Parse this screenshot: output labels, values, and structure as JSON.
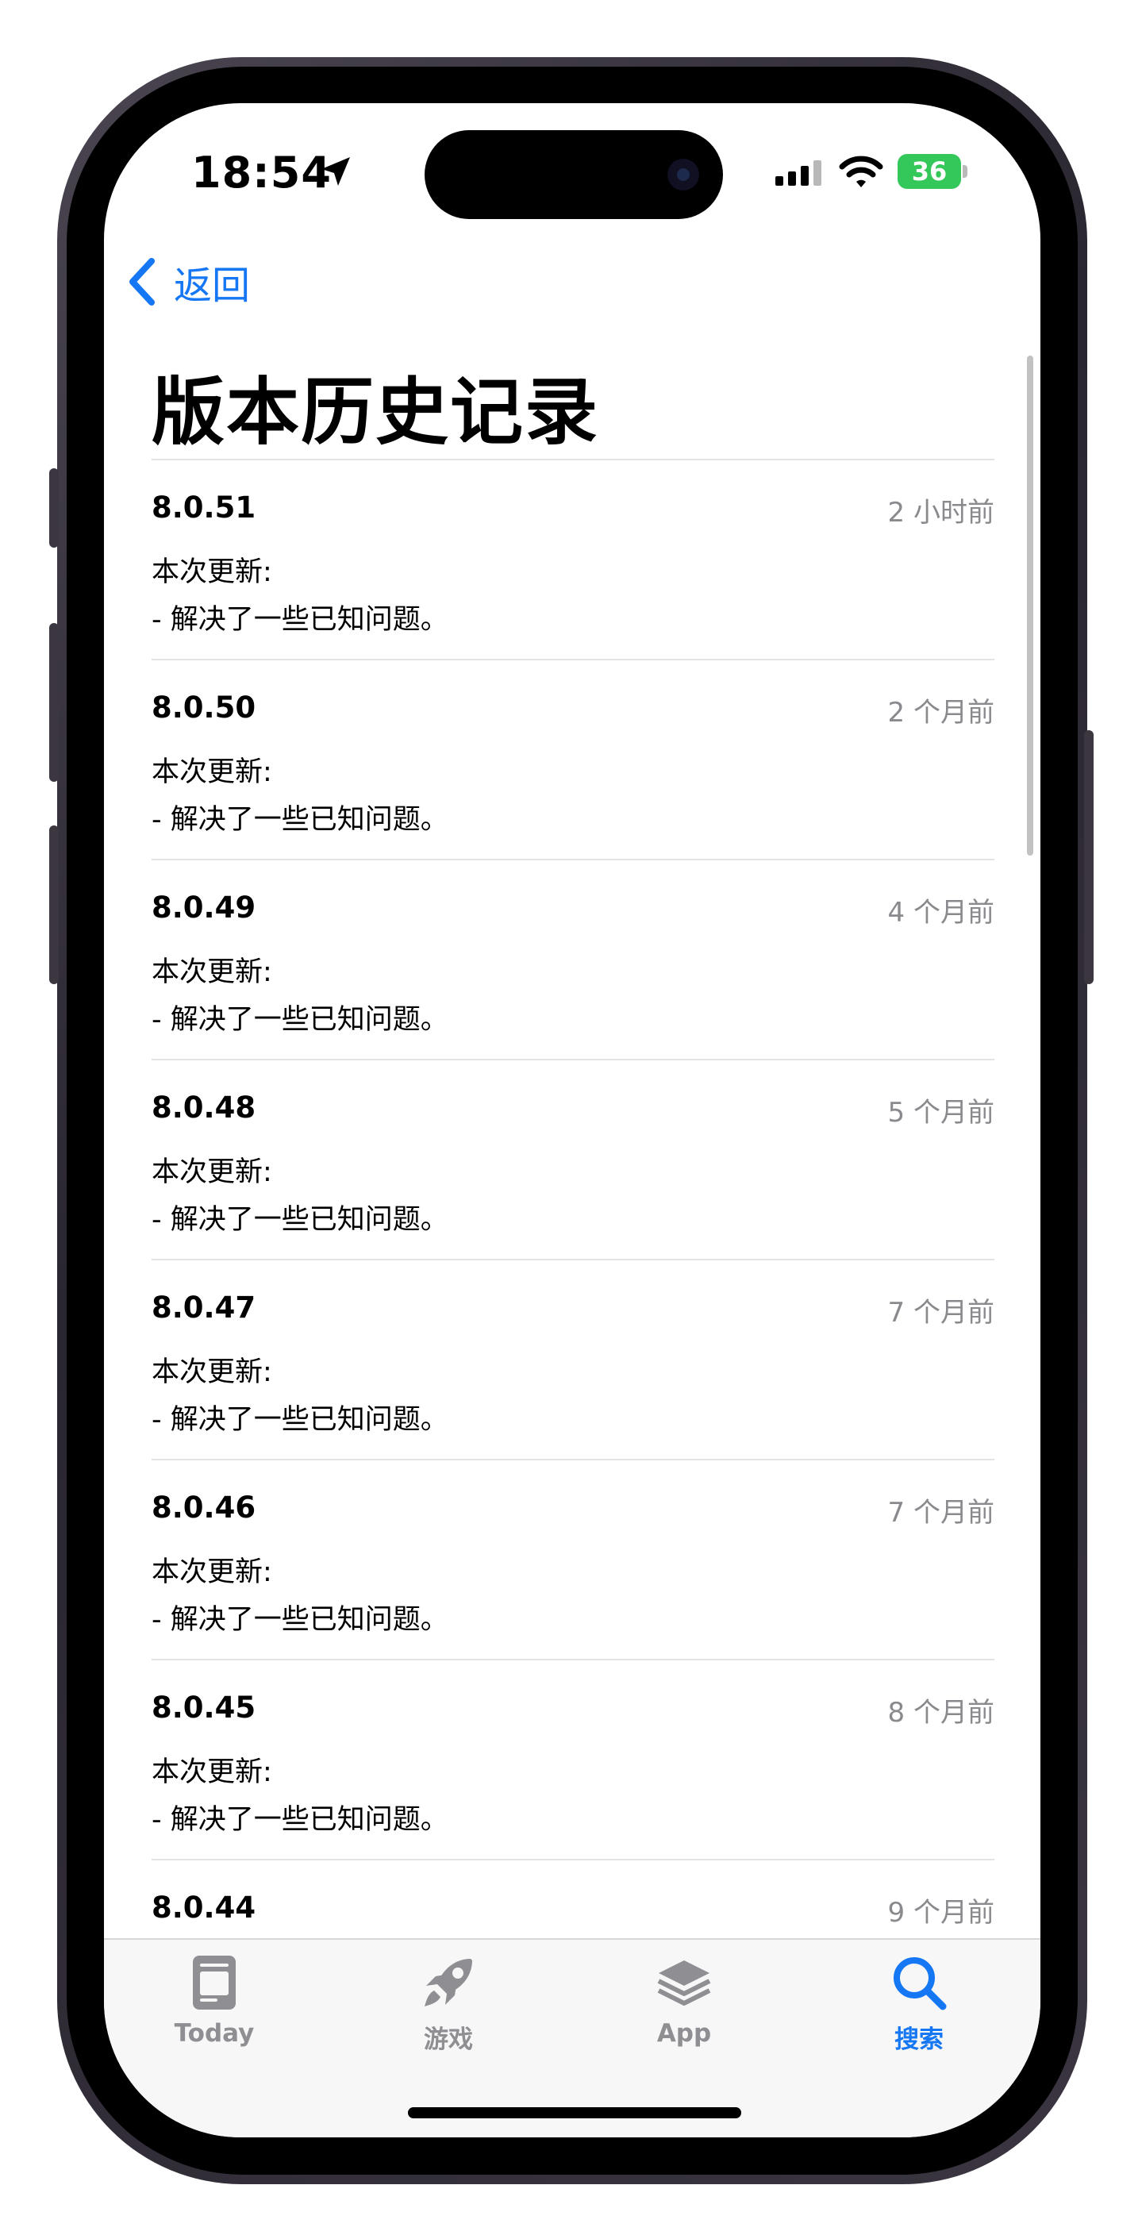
{
  "status_bar": {
    "time": "18:54",
    "battery": "36"
  },
  "nav": {
    "back_label": "返回"
  },
  "page": {
    "title": "版本历史记录"
  },
  "versions": [
    {
      "version": "8.0.51",
      "date": "2 小时前",
      "notes_heading": "本次更新:",
      "notes": "- 解决了一些已知问题。"
    },
    {
      "version": "8.0.50",
      "date": "2 个月前",
      "notes_heading": "本次更新:",
      "notes": "- 解决了一些已知问题。"
    },
    {
      "version": "8.0.49",
      "date": "4 个月前",
      "notes_heading": "本次更新:",
      "notes": "- 解决了一些已知问题。"
    },
    {
      "version": "8.0.48",
      "date": "5 个月前",
      "notes_heading": "本次更新:",
      "notes": "- 解决了一些已知问题。"
    },
    {
      "version": "8.0.47",
      "date": "7 个月前",
      "notes_heading": "本次更新:",
      "notes": "- 解决了一些已知问题。"
    },
    {
      "version": "8.0.46",
      "date": "7 个月前",
      "notes_heading": "本次更新:",
      "notes": "- 解决了一些已知问题。"
    },
    {
      "version": "8.0.45",
      "date": "8 个月前",
      "notes_heading": "本次更新:",
      "notes": "- 解决了一些已知问题。"
    },
    {
      "version": "8.0.44",
      "date": "9 个月前"
    }
  ],
  "tab_bar": {
    "tabs": [
      {
        "label": "Today",
        "icon": "today-icon",
        "active": false
      },
      {
        "label": "游戏",
        "icon": "rocket-icon",
        "active": false
      },
      {
        "label": "App",
        "icon": "app-stack-icon",
        "active": false
      },
      {
        "label": "搜索",
        "icon": "search-icon",
        "active": true
      }
    ]
  },
  "colors": {
    "accent": "#1577f3",
    "secondary_text": "#8a8a8e",
    "battery_green": "#34c759",
    "tab_inactive": "#8e8e93"
  }
}
